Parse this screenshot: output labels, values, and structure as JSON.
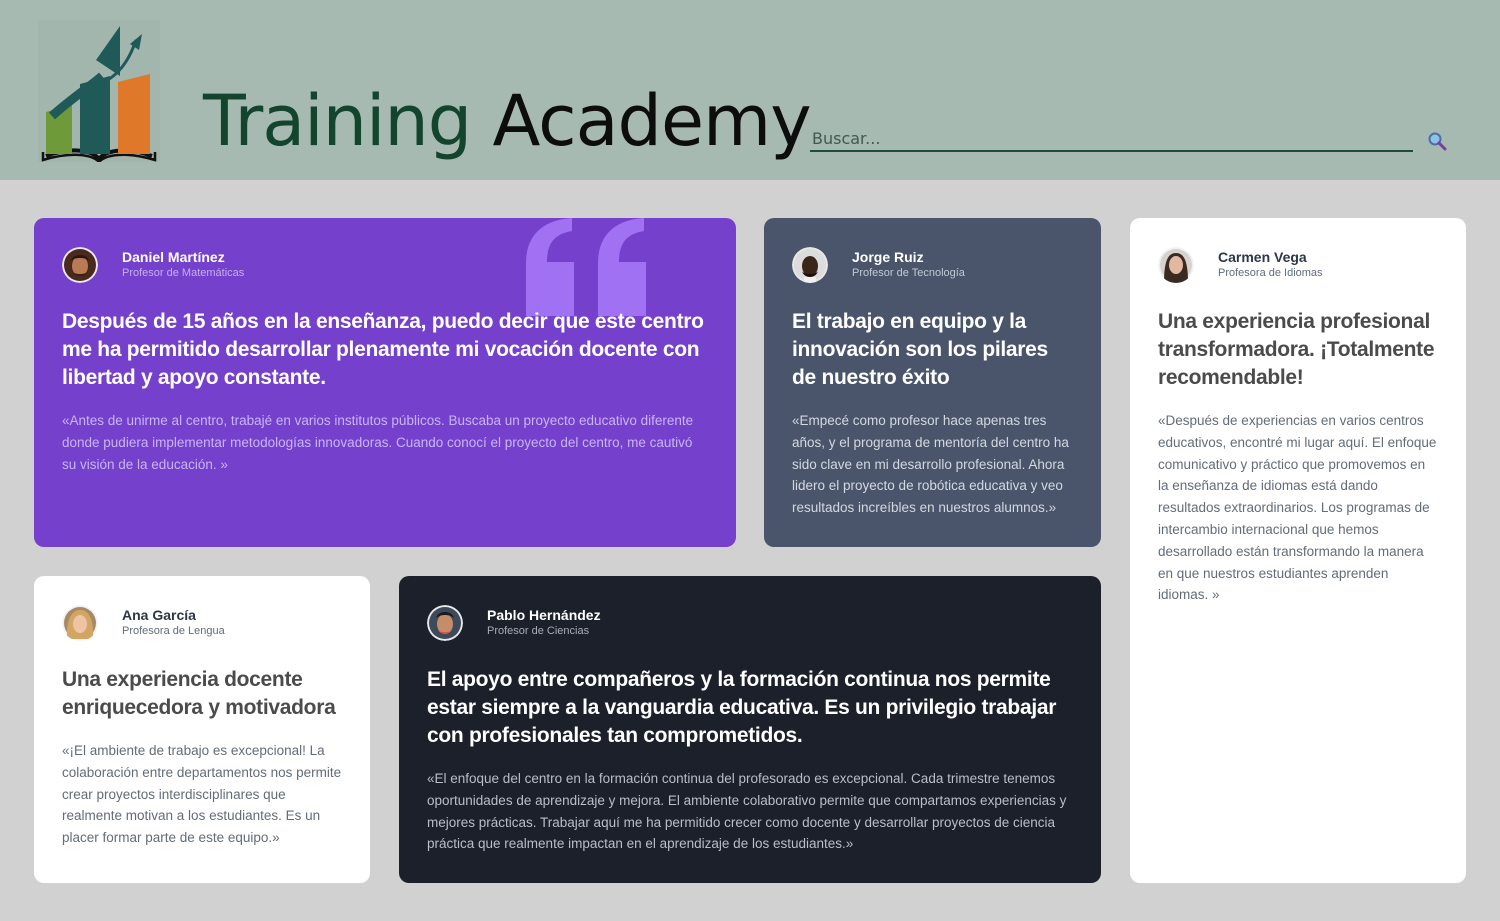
{
  "header": {
    "brand_part1": "Training",
    "brand_part2": "Academy",
    "search": {
      "placeholder": "Buscar..."
    }
  },
  "colors": {
    "header_bg": "#a7bab1",
    "page_bg": "#d1d1d1",
    "purple_card": "#7440cc",
    "slate_card": "#4a556b",
    "dark_card": "#1b202b",
    "brand_green": "#13442d"
  },
  "testimonials": [
    {
      "name": "Daniel Martínez",
      "role": "Profesor de Matemáticas",
      "headline": "Después de 15 años en la enseñanza, puedo decir que este centro me ha permitido desarrollar plenamente mi vocación docente con libertad y apoyo constante.",
      "body": "«Antes de unirme al centro, trabajé en varios institutos públicos. Buscaba un proyecto educativo diferente donde pudiera implementar metodologías innovadoras. Cuando conocí el proyecto del centro, me cautivó su visión de la educación. »"
    },
    {
      "name": "Jorge Ruiz",
      "role": "Profesor de Tecnología",
      "headline": "El trabajo en equipo y la innovación son los pilares de nuestro éxito",
      "body": "«Empecé como profesor hace apenas tres años, y el programa de mentoría del centro ha sido clave en mi desarrollo profesional. Ahora lidero el proyecto de robótica educativa y veo resultados increíbles en nuestros alumnos.»"
    },
    {
      "name": "Carmen Vega",
      "role": "Profesora de Idiomas",
      "headline": "Una experiencia profesional transformadora. ¡Totalmente recomendable!",
      "body": "«Después de experiencias en varios centros educativos, encontré mi lugar aquí. El enfoque comunicativo y práctico que promovemos en la enseñanza de idiomas está dando resultados extraordinarios. Los programas de intercambio internacional que hemos desarrollado están transformando la manera en que nuestros estudiantes aprenden idiomas. »"
    },
    {
      "name": "Ana García",
      "role": "Profesora de Lengua",
      "headline": "Una experiencia docente enriquecedora y motivadora",
      "body": "«¡El ambiente de trabajo es excepcional! La colaboración entre departamentos nos permite crear proyectos interdisciplinares que realmente motivan a los estudiantes. Es un placer formar parte de este equipo.»"
    },
    {
      "name": "Pablo Hernández",
      "role": "Profesor de Ciencias",
      "headline": "El apoyo entre compañeros y la formación continua nos permite estar siempre a la vanguardia educativa. Es un privilegio trabajar con profesionales tan comprometidos.",
      "body": "«El enfoque del centro en la formación continua del profesorado es excepcional. Cada trimestre tenemos oportunidades de aprendizaje y mejora. El ambiente colaborativo permite que compartamos experiencias y mejores prácticas. Trabajar aquí me ha permitido crecer como docente y desarrollar proyectos de ciencia práctica que realmente impactan en el aprendizaje de los estudiantes.»"
    }
  ]
}
